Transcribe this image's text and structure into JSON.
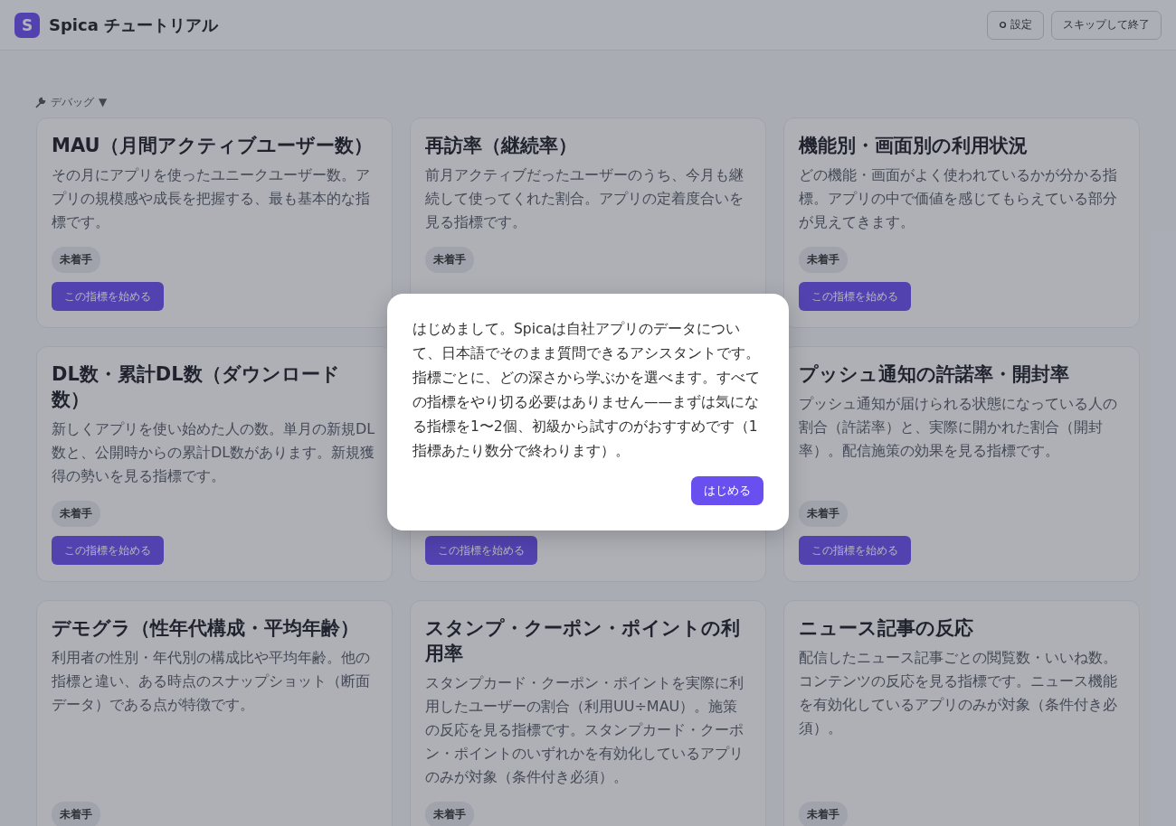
{
  "header": {
    "logo_letter": "S",
    "title": "Spica チュートリアル",
    "buttons": [
      {
        "label": "設定",
        "kind": "settings"
      },
      {
        "label": "スキップして終了",
        "kind": "plain"
      }
    ]
  },
  "debug": {
    "label": "デバッグ",
    "toggle": "▼"
  },
  "cards": [
    {
      "title": "MAU（月間アクティブユーザー数）",
      "description": "その月にアプリを使ったユニークユーザー数。アプリの規模感や成長を把握する、最も基本的な指標です。",
      "status": "未着手",
      "button": "この指標を始める"
    },
    {
      "title": "再訪率（継続率）",
      "description": "前月アクティブだったユーザーのうち、今月も継続して使ってくれた割合。アプリの定着度合いを見る指標です。",
      "status": "未着手"
    },
    {
      "title": "機能別・画面別の利用状況",
      "description": "どの機能・画面がよく使われているかが分かる指標。アプリの中で価値を感じてもらえている部分が見えてきます。",
      "status": "未着手",
      "button": "この指標を始める"
    },
    {
      "title": "DL数・累計DL数（ダウンロード数）",
      "description": "新しくアプリを使い始めた人の数。単月の新規DL数と、公開時からの累計DL数があります。新規獲得の勢いを見る指標です。",
      "status": "未着手",
      "button": "この指標を始める"
    },
    {
      "button": "この指標を始める"
    },
    {
      "title": "プッシュ通知の許諾率・開封率",
      "description": "プッシュ通知が届けられる状態になっている人の割合（許諾率）と、実際に開かれた割合（開封率）。配信施策の効果を見る指標です。",
      "status": "未着手",
      "button": "この指標を始める"
    },
    {
      "title": "デモグラ（性年代構成・平均年齢）",
      "description": "利用者の性別・年代別の構成比や平均年齢。他の指標と違い、ある時点のスナップショット（断面データ）である点が特徴です。",
      "status": "未着手"
    },
    {
      "title": "スタンプ・クーポン・ポイントの利用率",
      "description": "スタンプカード・クーポン・ポイントを実際に利用したユーザーの割合（利用UU÷MAU）。施策の反応を見る指標です。スタンプカード・クーポン・ポイントのいずれかを有効化しているアプリのみが対象（条件付き必須）。",
      "status": "未着手"
    },
    {
      "title": "ニュース記事の反応",
      "description": "配信したニュース記事ごとの閲覧数・いいね数。コンテンツの反応を見る指標です。ニュース機能を有効化しているアプリのみが対象（条件付き必須）。",
      "status": "未着手"
    }
  ],
  "dialog": {
    "message": "はじめまして。Spicaは自社アプリのデータについて、日本語でそのまま質問できるアシスタントです。指標ごとに、どの深さから学ぶかを選べます。すべての指標をやり切る必要はありません——まずは気になる指標を1〜2個、初級から試すのがおすすめです（1指標あたり数分で終わります）。",
    "button": "はじめる"
  }
}
